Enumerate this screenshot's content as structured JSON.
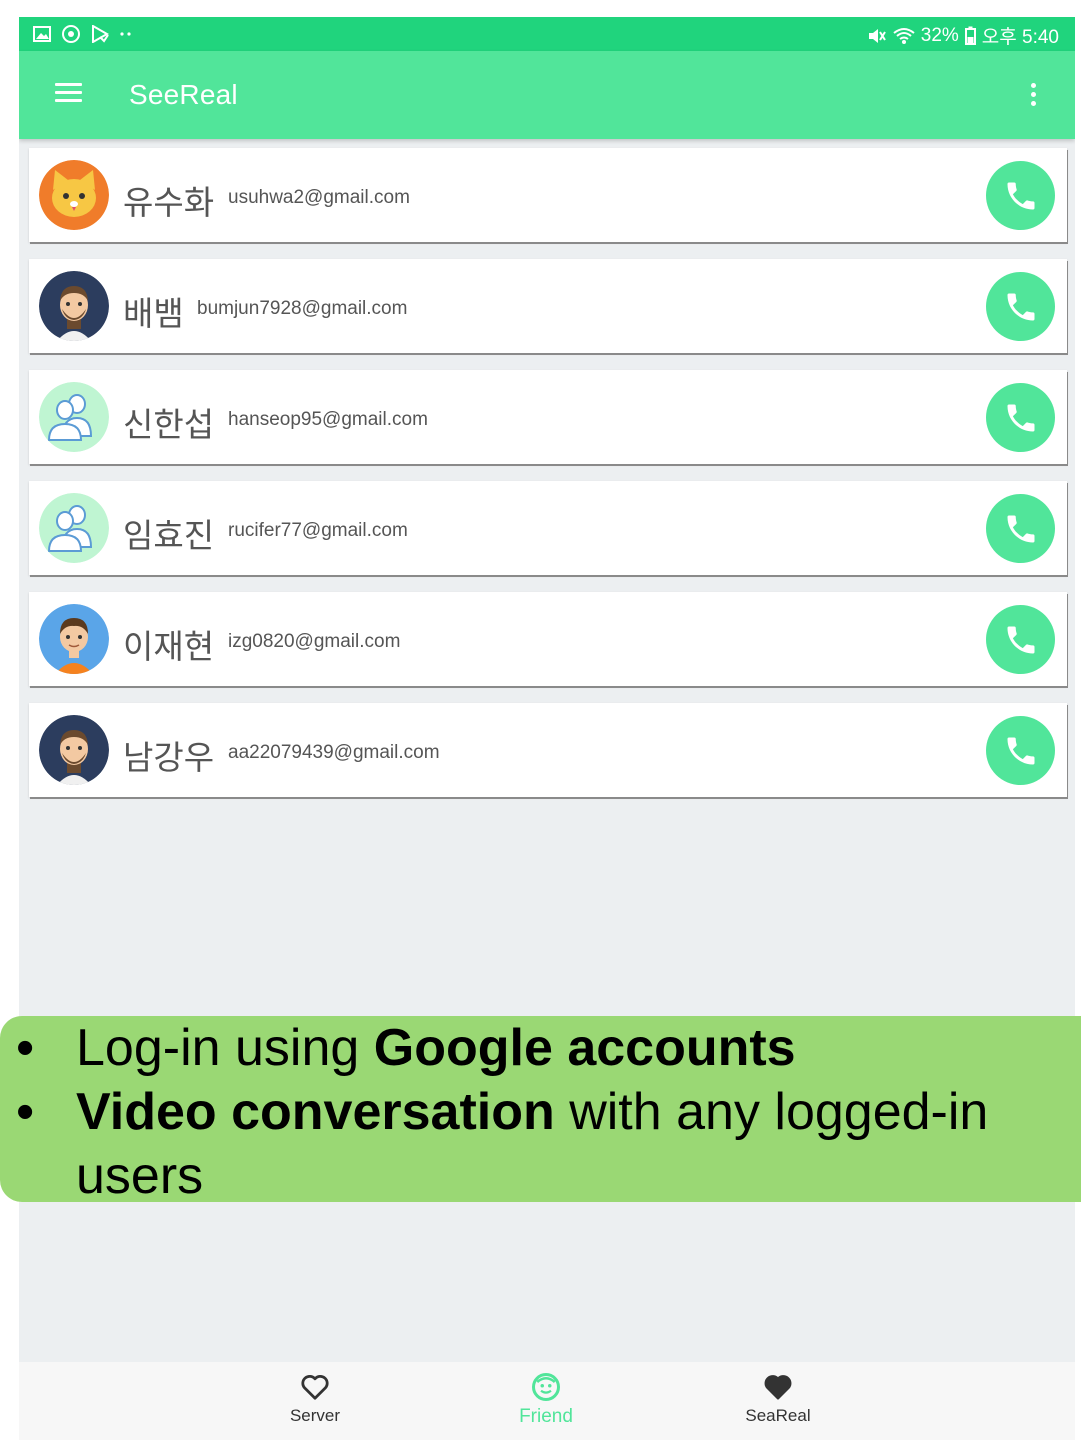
{
  "status_bar": {
    "battery": "32%",
    "time": "오후 5:40",
    "icons": [
      "gallery-icon",
      "sync-icon",
      "play-store-icon",
      "more-notifications-icon",
      "mute-icon",
      "wifi-icon",
      "battery-icon"
    ]
  },
  "app_bar": {
    "title": "SeeReal",
    "icons": [
      "menu-icon",
      "overflow-menu-icon"
    ]
  },
  "friends": [
    {
      "name": "유수화",
      "email": "usuhwa2@gmail.com",
      "avatar": "cat-avatar"
    },
    {
      "name": "배뱀",
      "email": "bumjun7928@gmail.com",
      "avatar": "man-beard-avatar"
    },
    {
      "name": "신한섭",
      "email": "hanseop95@gmail.com",
      "avatar": "default-people-avatar"
    },
    {
      "name": "임효진",
      "email": "rucifer77@gmail.com",
      "avatar": "default-people-avatar"
    },
    {
      "name": "이재현",
      "email": "izg0820@gmail.com",
      "avatar": "boy-avatar"
    },
    {
      "name": "남강우",
      "email": "aa22079439@gmail.com",
      "avatar": "man-beard-avatar"
    }
  ],
  "banner": {
    "line1_plain": "Log-in using ",
    "line1_bold": "Google accounts",
    "line2_bold": "Video conversation",
    "line2_plain": " with any logged-in users"
  },
  "bottom_nav": {
    "items": [
      {
        "label": "Server",
        "icon": "heart-outline-icon"
      },
      {
        "label": "Friend",
        "icon": "smiley-face-icon",
        "active": true
      },
      {
        "label": "SeaReal",
        "icon": "heart-filled-icon"
      }
    ]
  },
  "colors": {
    "status_bar": "#20d47d",
    "app_bar": "#51e59a",
    "call_button": "#51e59a",
    "banner": "#9ad874",
    "background": "#eceff1"
  }
}
